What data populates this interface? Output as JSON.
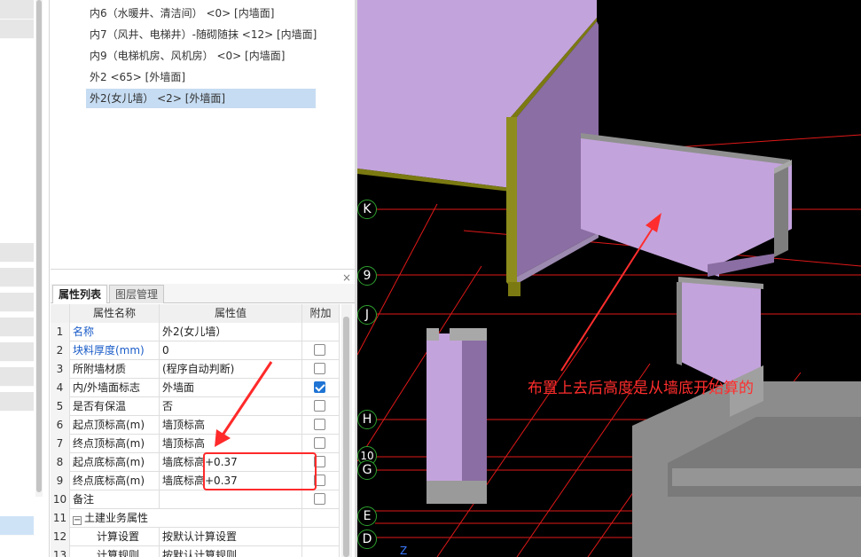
{
  "tree": {
    "items": [
      {
        "label": "内6（水暖井、清洁间） <0> [内墙面]"
      },
      {
        "label": "内7（风井、电梯井）-随砌随抹 <12> [内墙面]"
      },
      {
        "label": "内9（电梯机房、风机房） <0> [内墙面]"
      },
      {
        "label": "外2 <65> [外墙面]"
      },
      {
        "label": "外2(女儿墙） <2> [外墙面]",
        "selected": true
      }
    ]
  },
  "property_panel": {
    "close_glyph": "×",
    "tabs": [
      {
        "label": "属性列表",
        "active": true
      },
      {
        "label": "图层管理",
        "active": false
      }
    ],
    "columns": {
      "name": "属性名称",
      "value": "属性值",
      "extra": "附加"
    },
    "rows": [
      {
        "no": "1",
        "name": "名称",
        "value": "外2(女儿墙）",
        "blue": true,
        "checkbox": "none"
      },
      {
        "no": "2",
        "name": "块料厚度(mm)",
        "value": "0",
        "blue": true,
        "checkbox": "off"
      },
      {
        "no": "3",
        "name": "所附墙材质",
        "value": "(程序自动判断)",
        "blue": false,
        "checkbox": "off"
      },
      {
        "no": "4",
        "name": "内/外墙面标志",
        "value": "外墙面",
        "blue": false,
        "checkbox": "on"
      },
      {
        "no": "5",
        "name": "是否有保温",
        "value": "否",
        "blue": false,
        "checkbox": "off"
      },
      {
        "no": "6",
        "name": "起点顶标高(m)",
        "value": "墙顶标高",
        "blue": false,
        "checkbox": "off"
      },
      {
        "no": "7",
        "name": "终点顶标高(m)",
        "value": "墙顶标高",
        "blue": false,
        "checkbox": "off"
      },
      {
        "no": "8",
        "name": "起点底标高(m)",
        "value": "墙底标高+0.37",
        "blue": false,
        "checkbox": "off"
      },
      {
        "no": "9",
        "name": "终点底标高(m)",
        "value": "墙底标高+0.37",
        "blue": false,
        "checkbox": "off"
      },
      {
        "no": "10",
        "name": "备注",
        "value": "",
        "blue": false,
        "checkbox": "off"
      },
      {
        "no": "11",
        "name": "土建业务属性",
        "value": "",
        "blue": false,
        "checkbox": "none",
        "group": true,
        "expander": "−"
      },
      {
        "no": "12",
        "name": "计算设置",
        "value": "按默认计算设置",
        "blue": false,
        "checkbox": "none",
        "child": true
      },
      {
        "no": "13",
        "name": "计算规则",
        "value": "按默认计算规则",
        "blue": false,
        "checkbox": "none",
        "child": true
      }
    ]
  },
  "viewport": {
    "axis_labels": [
      {
        "text": "K"
      },
      {
        "text": "9"
      },
      {
        "text": "J"
      },
      {
        "text": "H"
      },
      {
        "text": "10"
      },
      {
        "text": "G"
      },
      {
        "text": "E"
      },
      {
        "text": "D"
      }
    ],
    "annotation": "布置上去后高度是从墙底开始算的",
    "corner_glyph": "Z",
    "colors": {
      "wall_face": "#c3a3dc",
      "wall_side": "#8b6ea3",
      "olive": "#7b7a12",
      "gray_wall": "#8c8c8c",
      "grid_red": "#e01818",
      "annotation_red": "#ff2d2d"
    }
  }
}
